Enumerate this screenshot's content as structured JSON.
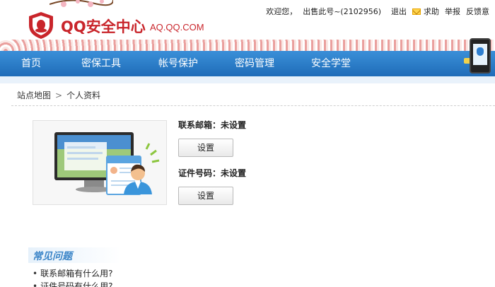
{
  "header": {
    "logo_text": "QQ安全中心",
    "logo_url": "AQ.QQ.COM",
    "welcome": "欢迎您，",
    "account": "出售此号~(2102956)",
    "logout": "退出",
    "help": "求助",
    "report": "举报",
    "feedback": "反馈意"
  },
  "nav": {
    "items": [
      {
        "label": "首页"
      },
      {
        "label": "密保工具"
      },
      {
        "label": "帐号保护"
      },
      {
        "label": "密码管理"
      },
      {
        "label": "安全学堂"
      }
    ]
  },
  "breadcrumb": {
    "root": "站点地图",
    "separator": ">",
    "current": "个人资料"
  },
  "profile": {
    "email_label": "联系邮箱：",
    "email_value": "未设置",
    "email_button": "设置",
    "id_label": "证件号码：",
    "id_value": "未设置",
    "id_button": "设置"
  },
  "faq": {
    "title": "常见问题",
    "items": [
      "联系邮箱有什么用?",
      "证件号码有什么用?"
    ]
  },
  "colors": {
    "brand_red": "#c9252b",
    "nav_blue": "#2a7cc8",
    "faq_blue": "#3b85c8"
  }
}
